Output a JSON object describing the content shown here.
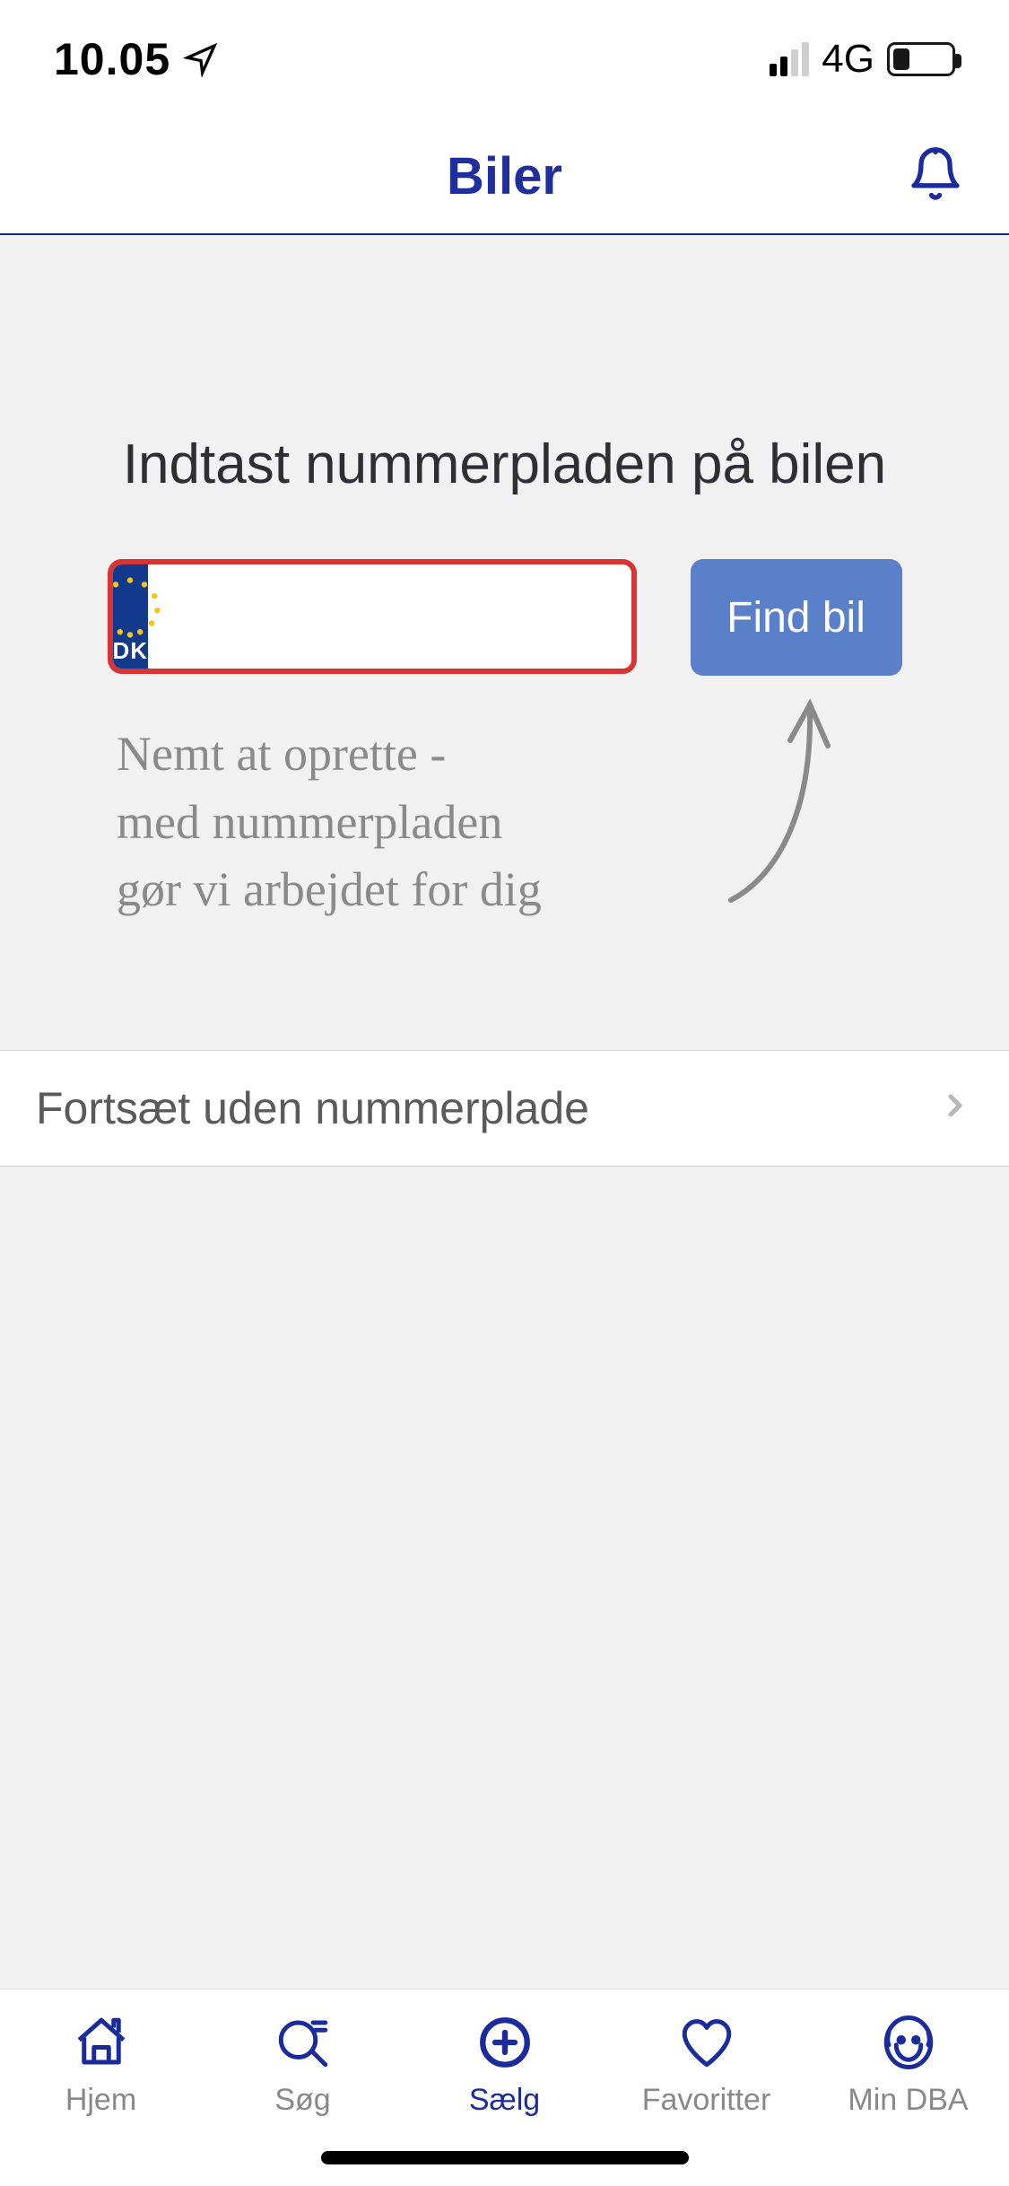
{
  "status": {
    "time": "10.05",
    "network_label": "4G"
  },
  "header": {
    "title": "Biler"
  },
  "plate": {
    "heading": "Indtast nummerpladen på bilen",
    "country_code": "DK",
    "input_value": "",
    "find_button": "Find bil",
    "hint_line1": "Nemt at oprette -",
    "hint_line2": "med nummerpladen",
    "hint_line3": "gør vi arbejdet for dig"
  },
  "skip": {
    "label": "Fortsæt uden nummerplade"
  },
  "tabs": {
    "home": "Hjem",
    "search": "Søg",
    "sell": "Sælg",
    "favorites": "Favoritter",
    "mydba": "Min DBA"
  },
  "colors": {
    "brand": "#1a2b9b",
    "button": "#5a80c9",
    "plate_border": "#d93434",
    "eu_blue": "#13398d"
  }
}
